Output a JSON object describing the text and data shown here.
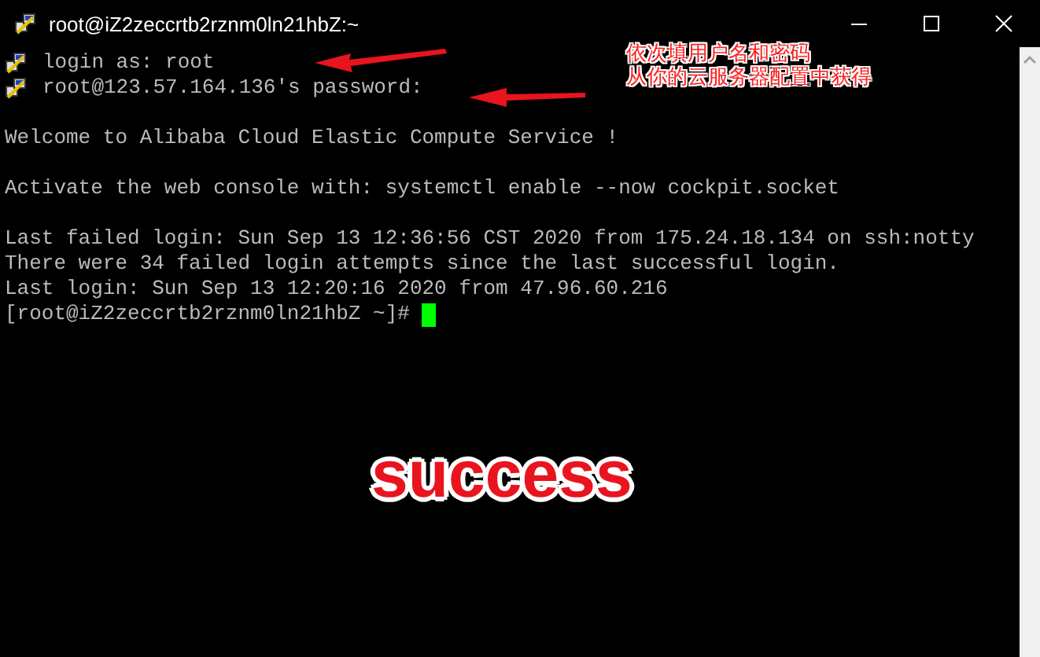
{
  "window": {
    "title": "root@iZ2zeccrtb2rznm0ln21hbZ:~"
  },
  "terminal": {
    "lines": [
      {
        "kind": "event",
        "text": "login as: root"
      },
      {
        "kind": "event",
        "text": "root@123.57.164.136's password:"
      },
      {
        "kind": "blank"
      },
      {
        "kind": "output",
        "text": "Welcome to Alibaba Cloud Elastic Compute Service !"
      },
      {
        "kind": "blank"
      },
      {
        "kind": "output",
        "text": "Activate the web console with: systemctl enable --now cockpit.socket"
      },
      {
        "kind": "blank"
      },
      {
        "kind": "output",
        "text": "Last failed login: Sun Sep 13 12:36:56 CST 2020 from 175.24.18.134 on ssh:notty"
      },
      {
        "kind": "output",
        "text": "There were 34 failed login attempts since the last successful login."
      },
      {
        "kind": "output",
        "text": "Last login: Sun Sep 13 12:20:16 2020 from 47.96.60.216"
      },
      {
        "kind": "prompt",
        "text": "[root@iZ2zeccrtb2rznm0ln21hbZ ~]#"
      }
    ]
  },
  "annotations": {
    "note_lines": [
      "依次填用户名和密码",
      "从你的云服务器配置中获得"
    ],
    "stamp": "success"
  }
}
